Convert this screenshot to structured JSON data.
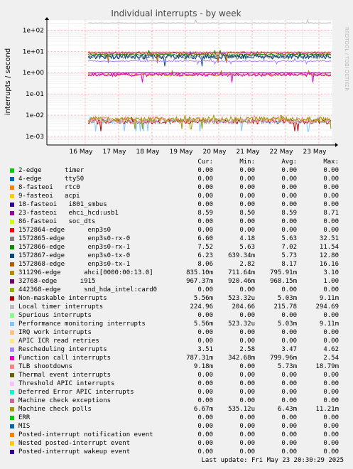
{
  "chart_data": {
    "type": "line",
    "title": "Individual interrupts - by week",
    "ylabel": "interrupts / second",
    "y_scale": "log",
    "ylim": [
      0.0004,
      300
    ],
    "y_ticks": [
      0.001,
      0.01,
      0.1,
      1,
      10,
      100
    ],
    "y_tick_labels": [
      "1e-03",
      "1e-02",
      "1e-01",
      "1e+00",
      "1e+01",
      "1e+02"
    ],
    "x_tick_labels": [
      "16 May",
      "17 May",
      "18 May",
      "19 May",
      "20 May",
      "21 May",
      "22 May",
      "23 May"
    ],
    "grid": true,
    "watermark": "RRDTOOL / TOBI OETIKER",
    "series": [
      {
        "name": "2-edge      timer",
        "color": "#00cc00",
        "cur": "0.00",
        "min": "0.00",
        "avg": "0.00",
        "max": "0.00"
      },
      {
        "name": "4-edge      ttyS0",
        "color": "#0066b3",
        "cur": "0.00",
        "min": "0.00",
        "avg": "0.00",
        "max": "0.00"
      },
      {
        "name": "8-fasteoi   rtc0",
        "color": "#ff8000",
        "cur": "0.00",
        "min": "0.00",
        "avg": "0.00",
        "max": "0.00"
      },
      {
        "name": "9-fasteoi   acpi",
        "color": "#ffcc00",
        "cur": "0.00",
        "min": "0.00",
        "avg": "0.00",
        "max": "0.00"
      },
      {
        "name": "18-fasteoi   i801_smbus",
        "color": "#330099",
        "cur": "0.00",
        "min": "0.00",
        "avg": "0.00",
        "max": "0.00"
      },
      {
        "name": "23-fasteoi   ehci_hcd:usb1",
        "color": "#990099",
        "cur": "8.59",
        "min": "8.50",
        "avg": "8.59",
        "max": "8.71"
      },
      {
        "name": "86-fasteoi   soc_dts",
        "color": "#ccff00",
        "cur": "0.00",
        "min": "0.00",
        "avg": "0.00",
        "max": "0.00"
      },
      {
        "name": "1572864-edge      enp3s0",
        "color": "#ff0000",
        "cur": "0.00",
        "min": "0.00",
        "avg": "0.00",
        "max": "0.00"
      },
      {
        "name": "1572865-edge      enp3s0-rx-0",
        "color": "#808080",
        "cur": "6.60",
        "min": "4.18",
        "avg": "5.63",
        "max": "32.51"
      },
      {
        "name": "1572866-edge      enp3s0-rx-1",
        "color": "#008f00",
        "cur": "7.52",
        "min": "5.63",
        "avg": "7.02",
        "max": "11.54"
      },
      {
        "name": "1572867-edge      enp3s0-tx-0",
        "color": "#00487d",
        "cur": "6.23",
        "min": "639.34m",
        "avg": "5.73",
        "max": "12.80"
      },
      {
        "name": "1572868-edge      enp3s0-tx-1",
        "color": "#b35a00",
        "cur": "8.06",
        "min": "2.82",
        "avg": "8.17",
        "max": "16.16"
      },
      {
        "name": "311296-edge      ahci[0000:00:13.0]",
        "color": "#b38f00",
        "cur": "835.10m",
        "min": "711.64m",
        "avg": "795.91m",
        "max": "3.10"
      },
      {
        "name": "32768-edge      i915",
        "color": "#6b006b",
        "cur": "967.37m",
        "min": "920.46m",
        "avg": "968.15m",
        "max": "1.00"
      },
      {
        "name": "442368-edge      snd_hda_intel:card0",
        "color": "#8fb300",
        "cur": "0.00",
        "min": "0.00",
        "avg": "0.00",
        "max": "0.00"
      },
      {
        "name": "Non-maskable interrupts",
        "color": "#b30000",
        "cur": "5.56m",
        "min": "523.32u",
        "avg": "5.03m",
        "max": "9.11m"
      },
      {
        "name": "Local timer interrupts",
        "color": "#bebebe",
        "cur": "224.96",
        "min": "204.66",
        "avg": "215.78",
        "max": "294.69"
      },
      {
        "name": "Spurious interrupts",
        "color": "#80ff80",
        "cur": "0.00",
        "min": "0.00",
        "avg": "0.00",
        "max": "0.00"
      },
      {
        "name": "Performance monitoring interrupts",
        "color": "#80c9ff",
        "cur": "5.56m",
        "min": "523.32u",
        "avg": "5.03m",
        "max": "9.11m"
      },
      {
        "name": "IRQ work interrupts",
        "color": "#ffc080",
        "cur": "0.00",
        "min": "0.00",
        "avg": "0.00",
        "max": "0.00"
      },
      {
        "name": "APIC ICR read retries",
        "color": "#ffe680",
        "cur": "0.00",
        "min": "0.00",
        "avg": "0.00",
        "max": "0.00"
      },
      {
        "name": "Rescheduling interrupts",
        "color": "#aa80ff",
        "cur": "3.51",
        "min": "2.58",
        "avg": "3.47",
        "max": "4.62"
      },
      {
        "name": "Function call interrupts",
        "color": "#ee00cc",
        "cur": "787.31m",
        "min": "342.68m",
        "avg": "799.96m",
        "max": "2.54"
      },
      {
        "name": "TLB shootdowns",
        "color": "#ff8080",
        "cur": "9.18m",
        "min": "0.00",
        "avg": "5.73m",
        "max": "18.79m"
      },
      {
        "name": "Thermal event interrupts",
        "color": "#666600",
        "cur": "0.00",
        "min": "0.00",
        "avg": "0.00",
        "max": "0.00"
      },
      {
        "name": "Threshold APIC interrupts",
        "color": "#ffbfff",
        "cur": "0.00",
        "min": "0.00",
        "avg": "0.00",
        "max": "0.00"
      },
      {
        "name": "Deferred Error APIC interrupts",
        "color": "#00ffcc",
        "cur": "0.00",
        "min": "0.00",
        "avg": "0.00",
        "max": "0.00"
      },
      {
        "name": "Machine check exceptions",
        "color": "#cc6699",
        "cur": "0.00",
        "min": "0.00",
        "avg": "0.00",
        "max": "0.00"
      },
      {
        "name": "Machine check polls",
        "color": "#999900",
        "cur": "6.67m",
        "min": "535.12u",
        "avg": "6.43m",
        "max": "11.21m"
      },
      {
        "name": "ERR",
        "color": "#00cc00",
        "cur": "0.00",
        "min": "0.00",
        "avg": "0.00",
        "max": "0.00"
      },
      {
        "name": "MIS",
        "color": "#0066b3",
        "cur": "0.00",
        "min": "0.00",
        "avg": "0.00",
        "max": "0.00"
      },
      {
        "name": "Posted-interrupt notification event",
        "color": "#ff8000",
        "cur": "0.00",
        "min": "0.00",
        "avg": "0.00",
        "max": "0.00"
      },
      {
        "name": "Nested posted-interrupt event",
        "color": "#ffcc00",
        "cur": "0.00",
        "min": "0.00",
        "avg": "0.00",
        "max": "0.00"
      },
      {
        "name": "Posted-interrupt wakeup event",
        "color": "#330099",
        "cur": "0.00",
        "min": "0.00",
        "avg": "0.00",
        "max": "0.00"
      }
    ]
  },
  "legend_headers": {
    "cur": "Cur:",
    "min": "Min:",
    "avg": "Avg:",
    "max": "Max:"
  },
  "footer": "Last update: Fri May 23 20:30:29 2025"
}
